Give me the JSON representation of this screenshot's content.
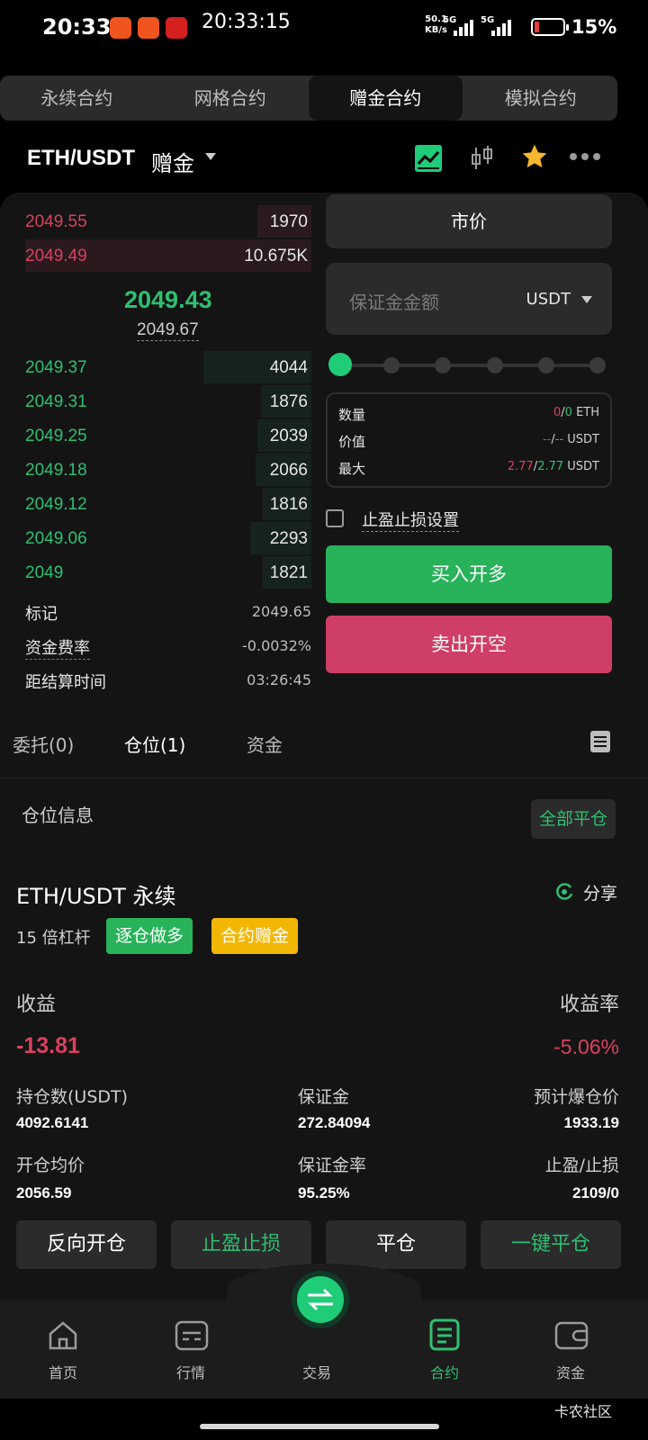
{
  "status_bar": {
    "time": "20:33",
    "time_secondary": "20:33:15",
    "net_speed_value": "50.1",
    "net_speed_unit": "KB/s",
    "signal_1": "5G",
    "signal_2": "5G",
    "battery_percent": "15%",
    "battery_level": 0.15,
    "battery_color": "#e53b3b"
  },
  "top_tabs": [
    "永续合约",
    "网格合约",
    "赠金合约",
    "模拟合约"
  ],
  "top_tabs_active": 2,
  "header": {
    "pair": "ETH/USDT",
    "tag": "赠金",
    "icons": [
      "chart-line-icon",
      "candlestick-icon",
      "star-icon",
      "more-icon"
    ]
  },
  "orderbook": {
    "asks": [
      {
        "price": "2049.55",
        "qty": "1970"
      },
      {
        "price": "2049.49",
        "qty": "10.675K"
      }
    ],
    "last_price": "2049.43",
    "mark_price": "2049.67",
    "bids": [
      {
        "price": "2049.37",
        "qty": "4044"
      },
      {
        "price": "2049.31",
        "qty": "1876"
      },
      {
        "price": "2049.25",
        "qty": "2039"
      },
      {
        "price": "2049.18",
        "qty": "2066"
      },
      {
        "price": "2049.12",
        "qty": "1816"
      },
      {
        "price": "2049.06",
        "qty": "2293"
      },
      {
        "price": "2049",
        "qty": "1821"
      }
    ]
  },
  "market_info": {
    "mark_label": "标记",
    "mark_value": "2049.65",
    "funding_label": "资金费率",
    "funding_value": "-0.0032%",
    "settle_label": "距结算时间",
    "settle_value": "03:26:45"
  },
  "order_form": {
    "order_type": "市价",
    "margin_placeholder": "保证金金额",
    "margin_currency": "USDT",
    "slider_percent": 0,
    "summary": {
      "qty_label": "数量",
      "qty_a": "0",
      "qty_b": "0",
      "qty_unit": "ETH",
      "value_label": "价值",
      "value_a": "--",
      "value_b": "--",
      "value_unit": "USDT",
      "max_label": "最大",
      "max_a": "2.77",
      "max_b": "2.77",
      "max_unit": "USDT"
    },
    "tpsl_label": "止盈止损设置",
    "buy_label": "买入开多",
    "sell_label": "卖出开空"
  },
  "sub_tabs": {
    "orders": "委托(0)",
    "positions": "仓位(1)",
    "assets": "资金"
  },
  "position": {
    "section_title": "仓位信息",
    "close_all": "全部平仓",
    "name": "ETH/USDT 永续",
    "share": "分享",
    "leverage": "15 倍杠杆",
    "tag_side": "逐仓做多",
    "tag_bonus": "合约赠金",
    "pnl_label": "收益",
    "pnl_value": "-13.81",
    "roi_label": "收益率",
    "roi_value": "-5.06%",
    "size_label": "持仓数(USDT)",
    "size_value": "4092.6141",
    "margin_label": "保证金",
    "margin_value": "272.84094",
    "liq_label": "预计爆仓价",
    "liq_value": "1933.19",
    "entry_label": "开仓均价",
    "entry_value": "2056.59",
    "margin_ratio_label": "保证金率",
    "margin_ratio_value": "95.25%",
    "tpsl_label": "止盈/止损",
    "tpsl_value": "2109/0",
    "actions": [
      "反向开仓",
      "止盈止损",
      "平仓",
      "一键平仓"
    ]
  },
  "bottom_nav": [
    "首页",
    "行情",
    "交易",
    "合约",
    "资金"
  ],
  "bottom_nav_active": 3,
  "watermark": "卡农社区",
  "colors": {
    "accent_green": "#2fbf71",
    "accent_red": "#d9415f",
    "buy_button": "#28b25a",
    "sell_button": "#cf3e66",
    "bonus_tag": "#f2b705"
  }
}
